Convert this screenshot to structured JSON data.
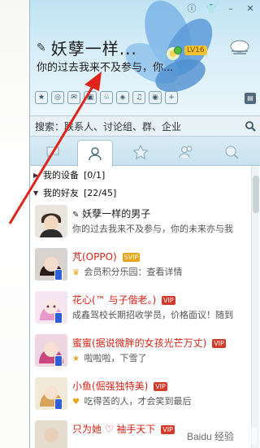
{
  "header": {
    "nickname": "妖孽一样...",
    "signature": "你的过去我来不及参与，你...",
    "level_badge": "LV16"
  },
  "search": {
    "placeholder": "搜索：联系人、讨论组、群、企业"
  },
  "groups": [
    {
      "label": "我的设备",
      "count": "[0/1]",
      "expanded": false
    },
    {
      "label": "我的好友",
      "count": "[22/45]",
      "expanded": true
    }
  ],
  "contacts": [
    {
      "name": "妖孽一样的男子",
      "signature": "你的过去我来不及参与，你的未来亦与我",
      "vip": "",
      "name_red": false,
      "lead_icon": "pencil-icon",
      "phone": false
    },
    {
      "name": "芃(OPPO)",
      "signature": "会员积分乐园：查看详情",
      "vip": "SVIP",
      "name_red": true,
      "lead_icon": "crown-icon",
      "phone": true
    },
    {
      "name": "花心(™ 与子偕老。)",
      "signature": "成鑫驾校长期招收学员，价格面议！随到",
      "vip": "VIP",
      "name_red": true,
      "lead_icon": "",
      "phone": true
    },
    {
      "name": "蜜蜜(据说微胖的女孩光芒万丈)",
      "signature": "啦啦啦，下雪了",
      "vip": "VIP",
      "name_red": true,
      "lead_icon": "star-icon",
      "phone": true
    },
    {
      "name": "小鱼(倔强独特美)",
      "signature": "吃得苦的人，才会笑到最后",
      "vip": "VIP",
      "name_red": true,
      "lead_icon": "heart-icon",
      "phone": true
    },
    {
      "name": "只为她 ♡ 袖手天下",
      "signature": "",
      "vip": "VIP",
      "name_red": true,
      "lead_icon": "",
      "phone": false
    }
  ],
  "watermark": "Baidu 经验",
  "colors": {
    "accent_red": "#d62418",
    "vip_gold": "#e8a317",
    "header_blue": "#bfe3f3",
    "arrow_red": "#e0241b"
  }
}
